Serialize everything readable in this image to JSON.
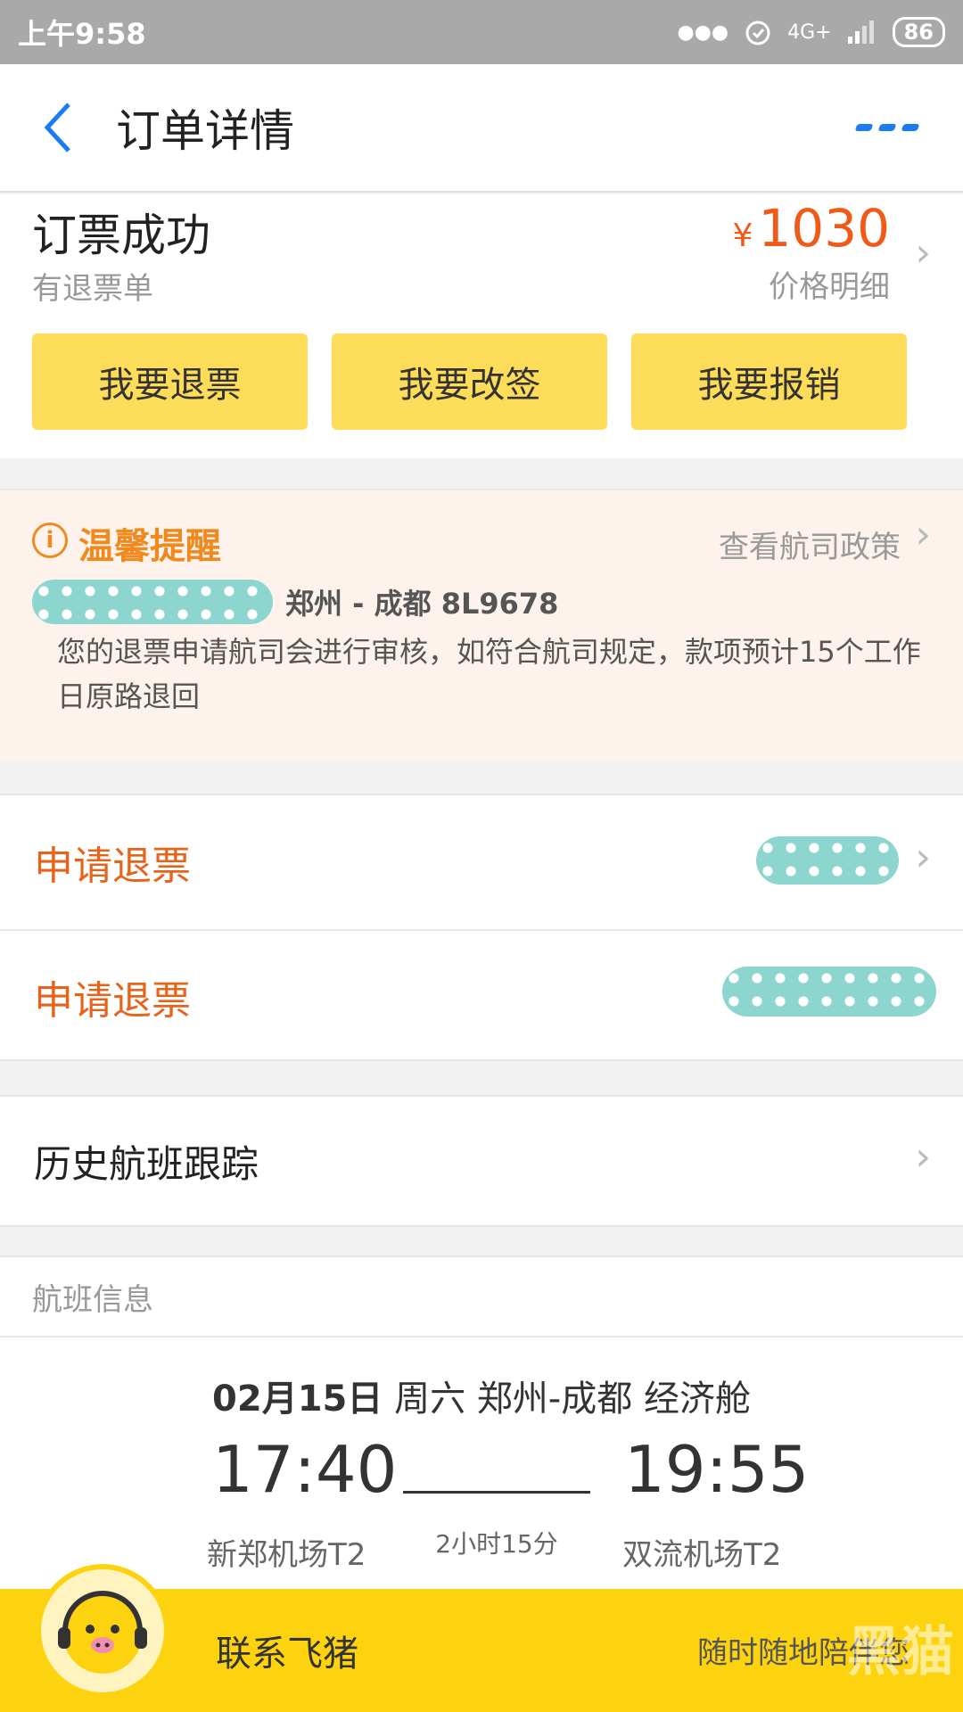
{
  "status_bar": {
    "time": "上午9:58",
    "network": "4G+",
    "battery": "86"
  },
  "nav": {
    "title": "订单详情"
  },
  "summary": {
    "status": "订票成功",
    "refund_note": "有退票单",
    "currency": "¥",
    "price": "1030",
    "price_detail": "价格明细",
    "buttons": [
      "我要退票",
      "我要改签",
      "我要报销"
    ]
  },
  "notice": {
    "title": "温馨提醒",
    "policy_link": "查看航司政策",
    "flight": "郑州 - 成都 8L9678",
    "body": "您的退票申请航司会进行审核，如符合航司规定，款项预计15个工作日原路退回"
  },
  "actions": [
    {
      "label": "申请退票"
    },
    {
      "label": "申请退票"
    }
  ],
  "history": {
    "label": "历史航班跟踪"
  },
  "flight": {
    "header": "航班信息",
    "date_prefix": "02月15日",
    "date_suffix": " 周六 郑州-成都 经济舱",
    "dep_time": "17:40",
    "arr_time": "19:55",
    "duration": "2小时15分",
    "dep_airport": "新郑机场T2",
    "arr_airport": "双流机场T2"
  },
  "bottom_bar": {
    "contact_label": "联系飞猪",
    "slogan": "随时随地陪伴您",
    "watermark": "黑猫"
  },
  "colors": {
    "accent_orange": "#f05a16",
    "button_yellow": "#fddc5a",
    "bar_yellow": "#fdd20f",
    "link_blue": "#1a7cf2"
  }
}
